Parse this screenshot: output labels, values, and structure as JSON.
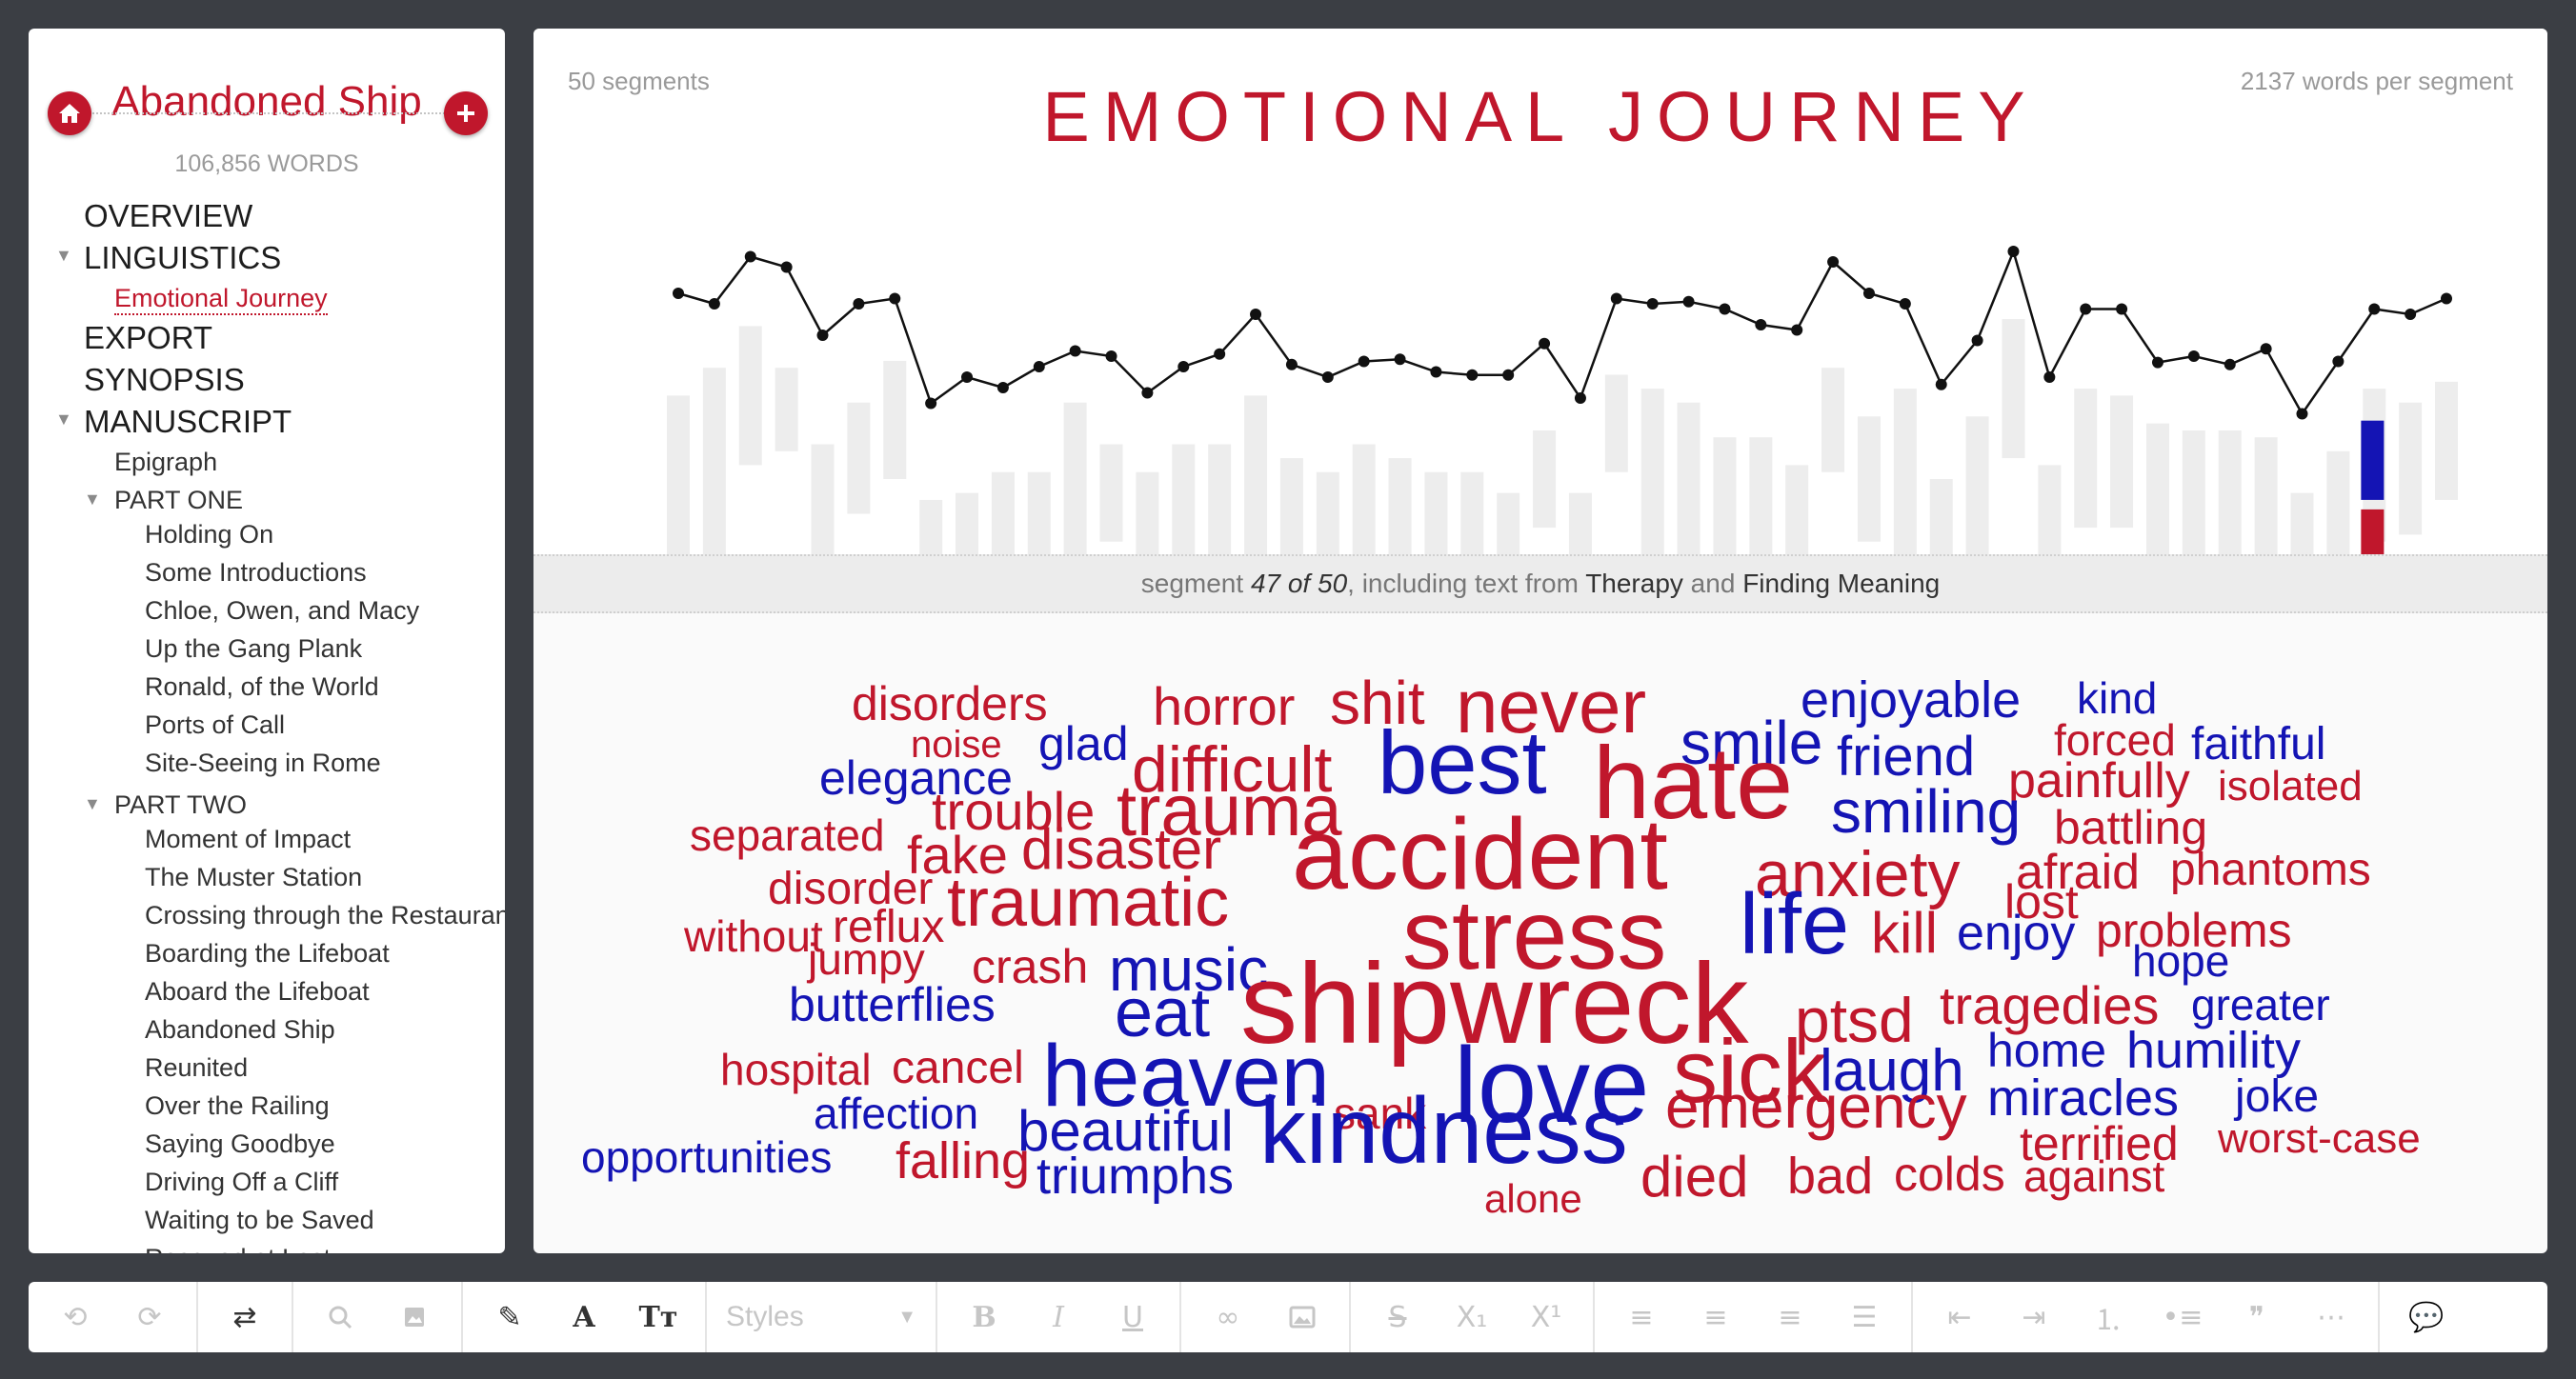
{
  "sidebar": {
    "book_title": "Abandoned Ship",
    "word_count": "106,856 WORDS",
    "nav": [
      {
        "label": "OVERVIEW",
        "level": 0,
        "toggle": false
      },
      {
        "label": "LINGUISTICS",
        "level": 0,
        "toggle": true
      },
      {
        "label": "Emotional Journey",
        "level": 1,
        "toggle": false,
        "active": true
      },
      {
        "label": "EXPORT",
        "level": 0,
        "toggle": false
      },
      {
        "label": "SYNOPSIS",
        "level": 0,
        "toggle": false
      },
      {
        "label": "MANUSCRIPT",
        "level": 0,
        "toggle": true
      },
      {
        "label": "Epigraph",
        "level": 1,
        "toggle": false
      },
      {
        "label": "PART ONE",
        "level": 1,
        "toggle": true
      },
      {
        "label": "Holding On",
        "level": 2
      },
      {
        "label": "Some Introductions",
        "level": 2
      },
      {
        "label": "Chloe, Owen, and Macy",
        "level": 2
      },
      {
        "label": "Up the Gang Plank",
        "level": 2
      },
      {
        "label": "Ronald, of the World",
        "level": 2
      },
      {
        "label": "Ports of Call",
        "level": 2
      },
      {
        "label": "Site-Seeing in Rome",
        "level": 2
      },
      {
        "label": "PART TWO",
        "level": 1,
        "toggle": true
      },
      {
        "label": "Moment of Impact",
        "level": 2
      },
      {
        "label": "The Muster Station",
        "level": 2
      },
      {
        "label": "Crossing through the Restaurant",
        "level": 2
      },
      {
        "label": "Boarding the Lifeboat",
        "level": 2
      },
      {
        "label": "Aboard the Lifeboat",
        "level": 2
      },
      {
        "label": "Abandoned Ship",
        "level": 2
      },
      {
        "label": "Reunited",
        "level": 2
      },
      {
        "label": "Over the Railing",
        "level": 2
      },
      {
        "label": "Saying Goodbye",
        "level": 2
      },
      {
        "label": "Driving Off a Cliff",
        "level": 2
      },
      {
        "label": "Waiting to be Saved",
        "level": 2
      },
      {
        "label": "Rescued at Last",
        "level": 2
      }
    ]
  },
  "main": {
    "segments_label": "50 segments",
    "words_per_segment": "2137 words per segment",
    "title": "EMOTIONAL JOURNEY",
    "segment_info": {
      "prefix": "segment ",
      "position": "47 of 50",
      "middle": ", including text from ",
      "chapter_a": "Therapy",
      "and": " and ",
      "chapter_b": "Finding Meaning"
    }
  },
  "chart_data": {
    "type": "line",
    "title": "EMOTIONAL JOURNEY",
    "x": [
      1,
      2,
      3,
      4,
      5,
      6,
      7,
      8,
      9,
      10,
      11,
      12,
      13,
      14,
      15,
      16,
      17,
      18,
      19,
      20,
      21,
      22,
      23,
      24,
      25,
      26,
      27,
      28,
      29,
      30,
      31,
      32,
      33,
      34,
      35,
      36,
      37,
      38,
      39,
      40,
      41,
      42,
      43,
      44,
      45,
      46,
      47,
      48,
      49,
      50
    ],
    "series": [
      {
        "values": [
          0.6,
          0.5,
          0.95,
          0.85,
          0.2,
          0.5,
          0.55,
          -0.45,
          -0.2,
          -0.3,
          -0.1,
          0.05,
          0.0,
          -0.35,
          -0.1,
          0.02,
          0.4,
          -0.08,
          -0.2,
          -0.05,
          -0.03,
          -0.15,
          -0.18,
          -0.18,
          0.12,
          -0.4,
          0.55,
          0.5,
          0.52,
          0.45,
          0.3,
          0.25,
          0.9,
          0.6,
          0.5,
          -0.27,
          0.15,
          1.0,
          -0.2,
          0.45,
          0.45,
          -0.06,
          0.0,
          -0.08,
          0.07,
          -0.55,
          -0.05,
          0.45,
          0.4,
          0.55
        ]
      }
    ],
    "range_bars": [
      [
        0.7,
        -0.7
      ],
      [
        0.9,
        -0.9
      ],
      [
        1.2,
        0.2
      ],
      [
        0.9,
        0.3
      ],
      [
        0.35,
        -0.45
      ],
      [
        0.65,
        -0.15
      ],
      [
        0.95,
        0.1
      ],
      [
        -0.05,
        -1.25
      ],
      [
        0.0,
        -1.25
      ],
      [
        0.15,
        -1.25
      ],
      [
        0.15,
        -0.55
      ],
      [
        0.65,
        -1.05
      ],
      [
        0.35,
        -0.35
      ],
      [
        0.15,
        -1.25
      ],
      [
        0.35,
        -1.05
      ],
      [
        0.35,
        -0.5
      ],
      [
        0.7,
        -0.65
      ],
      [
        0.25,
        -0.75
      ],
      [
        0.15,
        -0.95
      ],
      [
        0.35,
        -0.85
      ],
      [
        0.25,
        -0.75
      ],
      [
        0.15,
        -0.6
      ],
      [
        0.15,
        -1.05
      ],
      [
        0.0,
        -1.25
      ],
      [
        0.45,
        -0.25
      ],
      [
        0.0,
        -1.25
      ],
      [
        0.85,
        0.15
      ],
      [
        0.75,
        -0.55
      ],
      [
        0.65,
        -0.75
      ],
      [
        0.4,
        -0.55
      ],
      [
        0.4,
        -0.65
      ],
      [
        0.2,
        -0.6
      ],
      [
        0.9,
        0.15
      ],
      [
        0.55,
        -0.35
      ],
      [
        0.75,
        -0.75
      ],
      [
        0.1,
        -1.25
      ],
      [
        0.55,
        -0.8
      ],
      [
        1.25,
        0.25
      ],
      [
        0.2,
        -1.25
      ],
      [
        0.75,
        -0.25
      ],
      [
        0.7,
        -0.25
      ],
      [
        0.5,
        -0.8
      ],
      [
        0.45,
        -0.75
      ],
      [
        0.45,
        -1.05
      ],
      [
        0.4,
        -1.05
      ],
      [
        0.0,
        -1.25
      ],
      [
        0.3,
        -1.25
      ],
      [
        0.75,
        -0.35
      ],
      [
        0.65,
        -0.3
      ],
      [
        0.8,
        -0.05
      ]
    ],
    "selected_segment": 47,
    "selected_positive": 0.6,
    "selected_negative": 0.8,
    "colors": {
      "positive": "#1414b4",
      "negative": "#c0172c",
      "range": "#ededed",
      "line": "#111111"
    }
  },
  "word_cloud": [
    {
      "w": "disorders",
      "c": "red"
    },
    {
      "w": "horror",
      "c": "red"
    },
    {
      "w": "shit",
      "c": "red"
    },
    {
      "w": "never",
      "c": "red"
    },
    {
      "w": "enjoyable",
      "c": "blue"
    },
    {
      "w": "kind",
      "c": "blue"
    },
    {
      "w": "noise",
      "c": "red"
    },
    {
      "w": "glad",
      "c": "blue"
    },
    {
      "w": "smile",
      "c": "blue"
    },
    {
      "w": "forced",
      "c": "red"
    },
    {
      "w": "faithful",
      "c": "blue"
    },
    {
      "w": "elegance",
      "c": "blue"
    },
    {
      "w": "difficult",
      "c": "red"
    },
    {
      "w": "best",
      "c": "blue"
    },
    {
      "w": "hate",
      "c": "red"
    },
    {
      "w": "friend",
      "c": "blue"
    },
    {
      "w": "painfully",
      "c": "red"
    },
    {
      "w": "isolated",
      "c": "red"
    },
    {
      "w": "trouble",
      "c": "red"
    },
    {
      "w": "trauma",
      "c": "red"
    },
    {
      "w": "smiling",
      "c": "blue"
    },
    {
      "w": "separated",
      "c": "red"
    },
    {
      "w": "battling",
      "c": "red"
    },
    {
      "w": "fake",
      "c": "red"
    },
    {
      "w": "disaster",
      "c": "red"
    },
    {
      "w": "accident",
      "c": "red"
    },
    {
      "w": "anxiety",
      "c": "red"
    },
    {
      "w": "afraid",
      "c": "red"
    },
    {
      "w": "phantoms",
      "c": "red"
    },
    {
      "w": "disorder",
      "c": "red"
    },
    {
      "w": "traumatic",
      "c": "red"
    },
    {
      "w": "lost",
      "c": "red"
    },
    {
      "w": "without",
      "c": "red"
    },
    {
      "w": "reflux",
      "c": "red"
    },
    {
      "w": "stress",
      "c": "red"
    },
    {
      "w": "life",
      "c": "blue"
    },
    {
      "w": "kill",
      "c": "red"
    },
    {
      "w": "enjoy",
      "c": "blue"
    },
    {
      "w": "problems",
      "c": "red"
    },
    {
      "w": "jumpy",
      "c": "red"
    },
    {
      "w": "crash",
      "c": "red"
    },
    {
      "w": "music",
      "c": "blue"
    },
    {
      "w": "hope",
      "c": "blue"
    },
    {
      "w": "butterflies",
      "c": "blue"
    },
    {
      "w": "eat",
      "c": "blue"
    },
    {
      "w": "shipwreck",
      "c": "red"
    },
    {
      "w": "ptsd",
      "c": "red"
    },
    {
      "w": "tragedies",
      "c": "red"
    },
    {
      "w": "greater",
      "c": "blue"
    },
    {
      "w": "hospital",
      "c": "red"
    },
    {
      "w": "cancel",
      "c": "red"
    },
    {
      "w": "heaven",
      "c": "blue"
    },
    {
      "w": "love",
      "c": "blue"
    },
    {
      "w": "sick",
      "c": "red"
    },
    {
      "w": "home",
      "c": "blue"
    },
    {
      "w": "humility",
      "c": "blue"
    },
    {
      "w": "laugh",
      "c": "blue"
    },
    {
      "w": "joke",
      "c": "blue"
    },
    {
      "w": "affection",
      "c": "blue"
    },
    {
      "w": "sank",
      "c": "red"
    },
    {
      "w": "miracles",
      "c": "blue"
    },
    {
      "w": "beautiful",
      "c": "blue"
    },
    {
      "w": "emergency",
      "c": "red"
    },
    {
      "w": "worst-case",
      "c": "red"
    },
    {
      "w": "opportunities",
      "c": "blue"
    },
    {
      "w": "kindness",
      "c": "blue"
    },
    {
      "w": "terrified",
      "c": "red"
    },
    {
      "w": "falling",
      "c": "red"
    },
    {
      "w": "triumphs",
      "c": "blue"
    },
    {
      "w": "died",
      "c": "red"
    },
    {
      "w": "bad",
      "c": "red"
    },
    {
      "w": "colds",
      "c": "red"
    },
    {
      "w": "against",
      "c": "red"
    },
    {
      "w": "alone",
      "c": "red"
    }
  ],
  "toolbar": {
    "styles_placeholder": "Styles",
    "icons": [
      "undo-icon",
      "redo-icon",
      "sync-icon",
      "search-icon",
      "image-library-icon",
      "pen-icon",
      "font-color-icon",
      "text-size-icon",
      "bold-icon",
      "italic-icon",
      "underline-icon",
      "link-icon",
      "image-icon",
      "strikethrough-icon",
      "subscript-icon",
      "superscript-icon",
      "align-left-icon",
      "align-center-icon",
      "align-right-icon",
      "justify-icon",
      "outdent-icon",
      "indent-icon",
      "ordered-list-icon",
      "bullet-list-icon",
      "quote-icon",
      "more-icon",
      "comment-icon"
    ]
  }
}
